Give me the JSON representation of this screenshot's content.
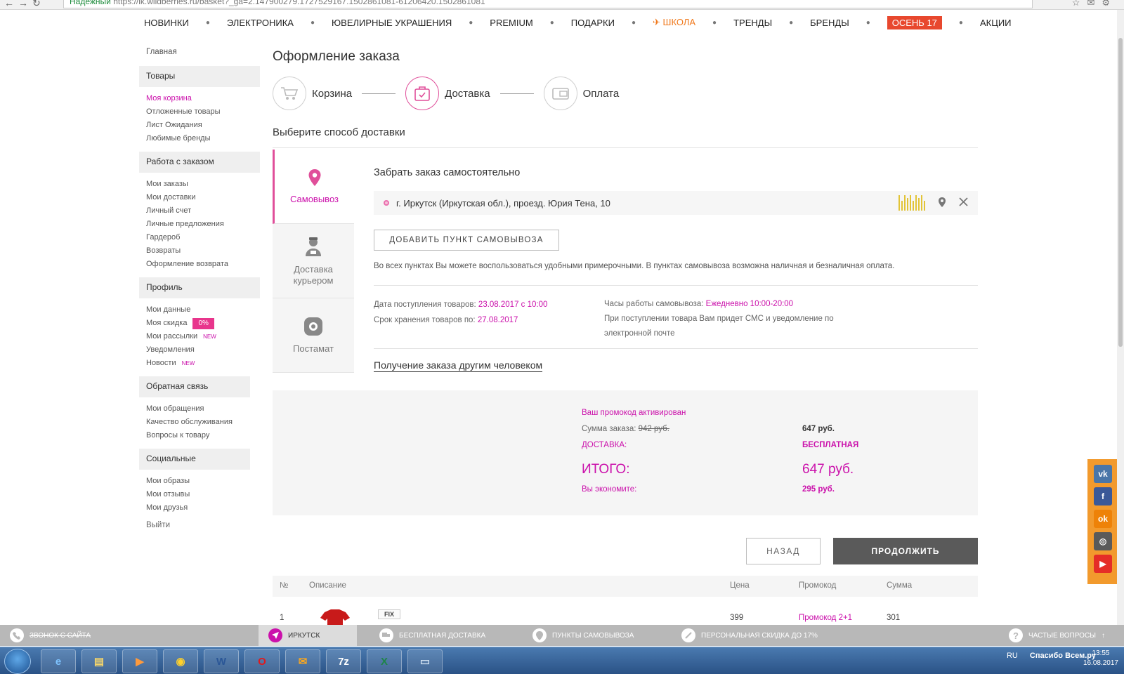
{
  "browser": {
    "secure_label": "Надежный",
    "url": "https://lk.wildberries.ru/basket?_ga=2.147900279.1727529167.1502861081-61206420.1502861081"
  },
  "topnav": [
    "НОВИНКИ",
    "ЭЛЕКТРОНИКА",
    "ЮВЕЛИРНЫЕ УКРАШЕНИЯ",
    "PREMIUM",
    "ПОДАРКИ",
    "ШКОЛА",
    "ТРЕНДЫ",
    "БРЕНДЫ",
    "ОСЕНЬ 17",
    "АКЦИИ"
  ],
  "sidebar": {
    "home": "Главная",
    "goods_head": "Товары",
    "goods": [
      "Моя корзина",
      "Отложенные товары",
      "Лист Ожидания",
      "Любимые бренды"
    ],
    "order_head": "Работа с заказом",
    "order": [
      "Мои заказы",
      "Мои доставки",
      "Личный счет",
      "Личные предложения",
      "Гардероб",
      "Возвраты",
      "Оформление возврата"
    ],
    "profile_head": "Профиль",
    "profile": {
      "data": "Мои данные",
      "discount": "Моя скидка",
      "discount_badge": "0%",
      "mailings": "Мои рассылки",
      "notifications": "Уведомления",
      "news": "Новости",
      "new_tag": "NEW"
    },
    "feedback_head": "Обратная связь",
    "feedback": [
      "Мои обращения",
      "Качество обслуживания",
      "Вопросы к товару"
    ],
    "social_head": "Социальные",
    "social": [
      "Мои образы",
      "Мои отзывы",
      "Мои друзья"
    ],
    "logout": "Выйти"
  },
  "main": {
    "title": "Оформление заказа",
    "steps": [
      "Корзина",
      "Доставка",
      "Оплата"
    ],
    "subtitle": "Выберите способ доставки",
    "tabs": {
      "pickup": "Самовывоз",
      "courier_1": "Доставка",
      "courier_2": "курьером",
      "postamat": "Постамат"
    },
    "pickup_title": "Забрать заказ самостоятельно",
    "address": "г. Иркутск (Иркутская обл.), проезд. Юрия Тена, 10",
    "add_point": "ДОБАВИТЬ ПУНКТ САМОВЫВОЗА",
    "note": "Во всех пунктах Вы можете воспользоваться удобными примерочными. В пунктах самовывоза возможна наличная и безналичная оплата.",
    "arrival_label": "Дата поступления товаров:",
    "arrival_value": "23.08.2017 с 10:00",
    "storage_label": "Срок хранения товаров по:",
    "storage_value": "27.08.2017",
    "hours_label": "Часы работы самовывоза:",
    "hours_value": "Ежедневно 10:00-20:00",
    "sms_note_1": "При поступлении товара Вам придет СМС и уведомление по",
    "sms_note_2": "электронной почте",
    "other_person": "Получение заказа другим человеком"
  },
  "summary": {
    "promo": "Ваш промокод активирован",
    "order_sum_label": "Сумма заказа:",
    "order_sum_old": "942 руб.",
    "order_sum_new": "647 руб.",
    "delivery_label": "ДОСТАВКА:",
    "delivery_value": "БЕСПЛАТНАЯ",
    "total_label": "ИТОГО:",
    "total_value": "647 руб.",
    "saved_label": "Вы экономите:",
    "saved_value": "295 руб."
  },
  "buttons": {
    "back": "НАЗАД",
    "next": "ПРОДОЛЖИТЬ"
  },
  "table": {
    "headers": [
      "№",
      "Описание",
      "Цена",
      "Промокод",
      "Сумма"
    ],
    "row": {
      "num": "1",
      "tag": "FIX",
      "price": "399",
      "promo": "Промокод 2+1",
      "sum": "301"
    }
  },
  "bottombar": {
    "call": "ЗВОНОК С САЙТА",
    "city": "ИРКУТСК",
    "free_delivery": "БЕСПЛАТНАЯ ДОСТАВКА",
    "points": "ПУНКТЫ САМОВЫВОЗА",
    "discount": "ПЕРСОНАЛЬНАЯ СКИДКА ДО 17%",
    "faq": "ЧАСТЫЕ ВОПРОСЫ"
  },
  "taskbar": {
    "lang": "RU",
    "time": "13:55",
    "date": "16.08.2017",
    "watermark": "Спасибо Всем.ру"
  },
  "social": [
    "vk-icon",
    "facebook-icon",
    "odnoklassniki-icon",
    "instagram-icon",
    "youtube-icon"
  ],
  "colors": {
    "accent": "#cb11ab",
    "pink": "#e04f9a",
    "autumn": "#e8482e",
    "school": "#f07a1e",
    "social_panel": "#f29a2d"
  }
}
